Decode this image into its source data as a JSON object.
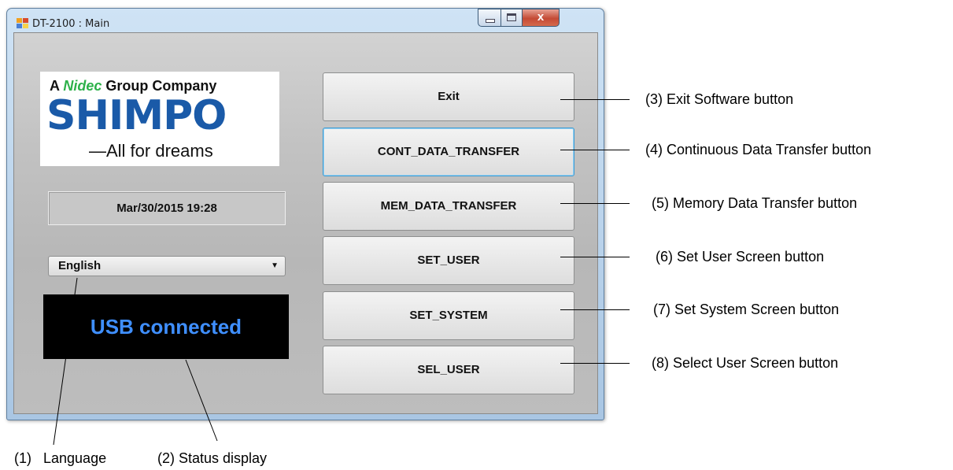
{
  "window": {
    "title": "DT-2100 : Main",
    "close_glyph": "x"
  },
  "logo": {
    "top_prefix": "A",
    "top_brand": "Nidec",
    "top_suffix": "Group Company",
    "main": "SHIMPO",
    "tagline": "All for dreams"
  },
  "datetime": "Mar/30/2015 19:28",
  "language": {
    "selected": "English"
  },
  "status": "USB connected",
  "buttons": {
    "exit": "Exit",
    "cont": "CONT_DATA_TRANSFER",
    "mem": "MEM_DATA_TRANSFER",
    "set_user": "SET_USER",
    "set_system": "SET_SYSTEM",
    "sel_user": "SEL_USER"
  },
  "annotations": {
    "exit": "(3) Exit Software button",
    "cont": "(4) Continuous Data Transfer button",
    "mem": "(5) Memory Data Transfer button",
    "set_user": "(6) Set User Screen button",
    "set_system": "(7) Set System Screen button",
    "sel_user": "(8) Select User Screen button",
    "language": "(1)   Language",
    "status": "(2) Status display"
  },
  "colors": {
    "status_text": "#3f8fff",
    "logo_blue": "#1a5aa8",
    "nidec_green": "#2db14a",
    "close_red": "#c44a35"
  }
}
